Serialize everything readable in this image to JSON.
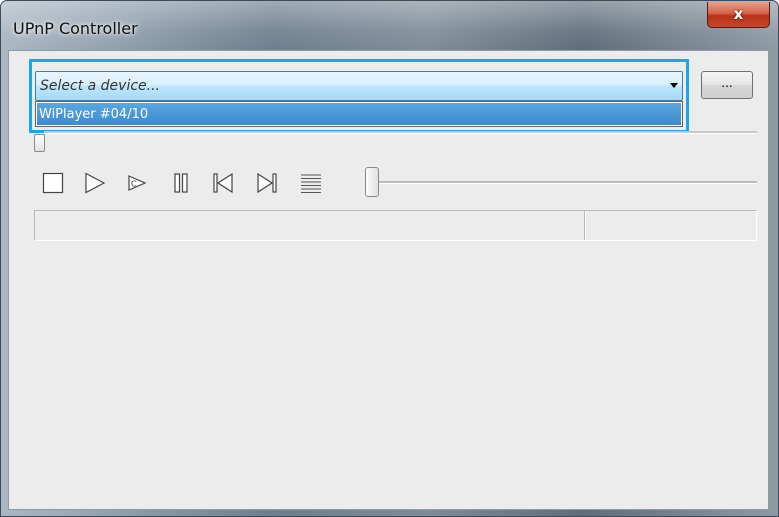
{
  "window": {
    "title": "UPnP Controller",
    "close_glyph": "x"
  },
  "device_combo": {
    "placeholder": "Select a device...",
    "options": [
      "WiPlayer #04/10"
    ],
    "highlighted_option": "WiPlayer #04/10"
  },
  "browse_button": {
    "label": "..."
  },
  "seek_slider": {
    "value": 0
  },
  "controls": [
    {
      "name": "stop",
      "icon": "stop-icon"
    },
    {
      "name": "play",
      "icon": "play-icon"
    },
    {
      "name": "play-continuous",
      "icon": "play-continuous-icon"
    },
    {
      "name": "pause",
      "icon": "pause-icon"
    },
    {
      "name": "previous",
      "icon": "skip-previous-icon"
    },
    {
      "name": "next",
      "icon": "skip-next-icon"
    },
    {
      "name": "playlist",
      "icon": "playlist-icon"
    }
  ],
  "volume_slider": {
    "value": 0
  },
  "status": {
    "left": "",
    "right": ""
  },
  "colors": {
    "highlight_frame": "#19a6ea",
    "selected_item": "#3d8ad0",
    "client_background": "#ececec"
  }
}
